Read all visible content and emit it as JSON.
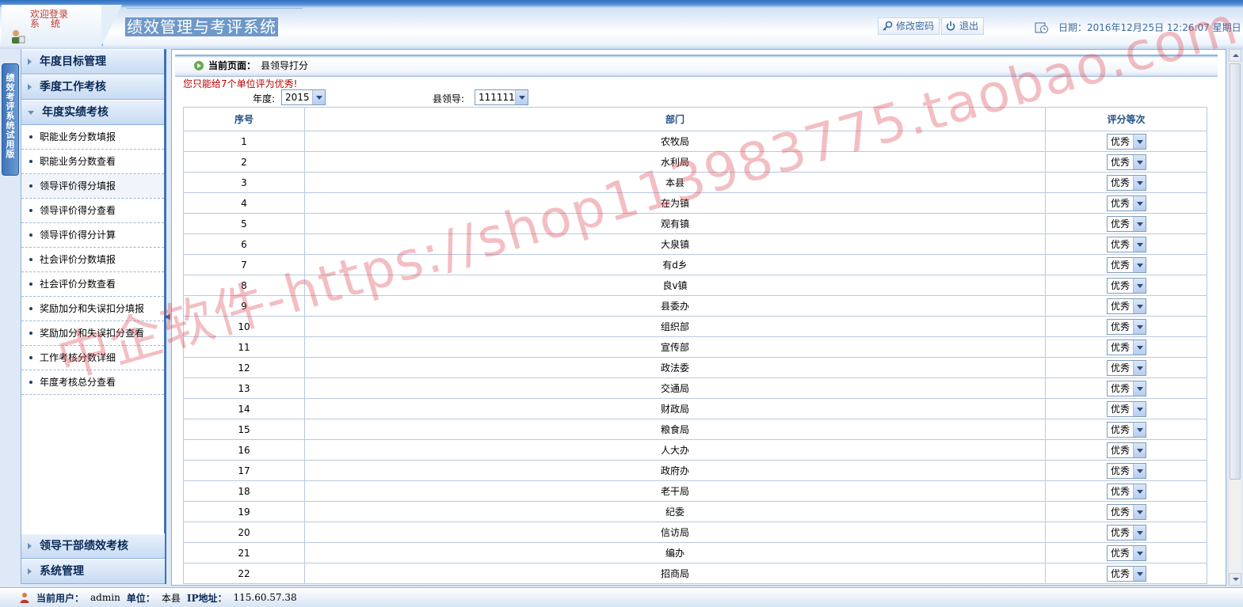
{
  "header": {
    "welcome_line1": "欢迎登录",
    "welcome_line2": "系统",
    "system_title": "绩效管理与考评系统",
    "change_password": "修改密码",
    "logout": "退出",
    "date_text": "日期：2016年12月25日 12:26:07 星期日"
  },
  "vertical_tab": {
    "label": "绩效考评系统试用版"
  },
  "sidebar": {
    "groups_top": [
      {
        "label": "年度目标管理",
        "expanded": false
      },
      {
        "label": "季度工作考核",
        "expanded": false
      },
      {
        "label": "年度实绩考核",
        "expanded": true
      }
    ],
    "sub_items": [
      "职能业务分数填报",
      "职能业务分数查看",
      "领导评价得分填报",
      "领导评价得分查看",
      "领导评价得分计算",
      "社会评价分数填报",
      "社会评价分数查看",
      "奖励加分和失误扣分填报",
      "奖励加分和失误扣分查看",
      "工作考核分数详细",
      "年度考核总分查看"
    ],
    "groups_bottom": [
      {
        "label": "领导干部绩效考核",
        "expanded": false
      },
      {
        "label": "系统管理",
        "expanded": false
      }
    ]
  },
  "main": {
    "crumb_label": "当前页面：",
    "crumb_value": "县领导打分",
    "notice": "您只能给7个单位评为优秀!",
    "year_label": "年度:",
    "year_value": "2015",
    "leader_label": "县领导:",
    "leader_value": "111111",
    "table": {
      "headers": [
        "序号",
        "部门",
        "评分等次"
      ],
      "rows": [
        [
          "1",
          "农牧局",
          "优秀"
        ],
        [
          "2",
          "水利局",
          "优秀"
        ],
        [
          "3",
          "本县",
          "优秀"
        ],
        [
          "4",
          "在为镇",
          "优秀"
        ],
        [
          "5",
          "观有镇",
          "优秀"
        ],
        [
          "6",
          "大泉镇",
          "优秀"
        ],
        [
          "7",
          "有d乡",
          "优秀"
        ],
        [
          "8",
          "良v镇",
          "优秀"
        ],
        [
          "9",
          "县委办",
          "优秀"
        ],
        [
          "10",
          "组织部",
          "优秀"
        ],
        [
          "11",
          "宣传部",
          "优秀"
        ],
        [
          "12",
          "政法委",
          "优秀"
        ],
        [
          "13",
          "交通局",
          "优秀"
        ],
        [
          "14",
          "财政局",
          "优秀"
        ],
        [
          "15",
          "粮食局",
          "优秀"
        ],
        [
          "16",
          "人大办",
          "优秀"
        ],
        [
          "17",
          "政府办",
          "优秀"
        ],
        [
          "18",
          "老干局",
          "优秀"
        ],
        [
          "19",
          "纪委",
          "优秀"
        ],
        [
          "20",
          "信访局",
          "优秀"
        ],
        [
          "21",
          "编办",
          "优秀"
        ],
        [
          "22",
          "招商局",
          "优秀"
        ]
      ]
    }
  },
  "statusbar": {
    "user_label": "当前用户：",
    "user_value": "admin",
    "unit_label": "单位：",
    "unit_value": "本县",
    "ip_label": "IP地址：",
    "ip_value": "115.60.57.38"
  },
  "watermark": {
    "text": "中企软件-https://shop113983775.taobao.com"
  },
  "colors": {
    "accent": "#3d74b8",
    "header_text": "#0b2a57",
    "notice": "#c00000",
    "table_header": "#1f4f86"
  },
  "icons": [
    "user-icon",
    "key-icon",
    "power-icon",
    "clock-icon",
    "play-icon",
    "chevron-down-icon"
  ]
}
